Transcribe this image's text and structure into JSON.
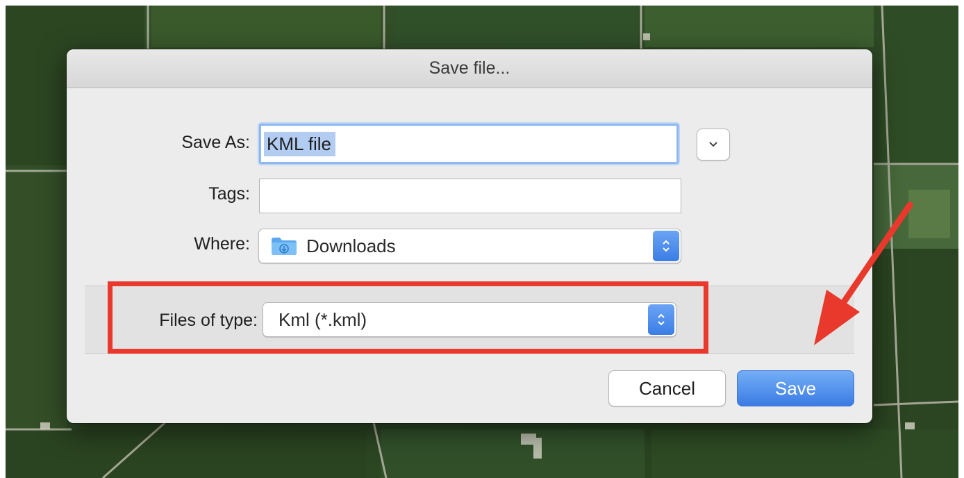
{
  "dialog": {
    "title": "Save file...",
    "save_as_label": "Save As:",
    "save_as_value": "KML file",
    "tags_label": "Tags:",
    "tags_value": "",
    "where_label": "Where:",
    "where_value": "Downloads",
    "file_type_label": "Files of type:",
    "file_type_value": "Kml (*.kml)",
    "cancel_label": "Cancel",
    "save_label": "Save"
  },
  "colors": {
    "highlight": "#e8392c",
    "accent": "#3b7ce4",
    "map_field": "#2f4a24"
  },
  "icons": {
    "expand": "chevron-down-icon",
    "folder": "downloads-folder-icon",
    "stepper": "up-down-stepper-icon",
    "annotation": "red-arrow"
  }
}
